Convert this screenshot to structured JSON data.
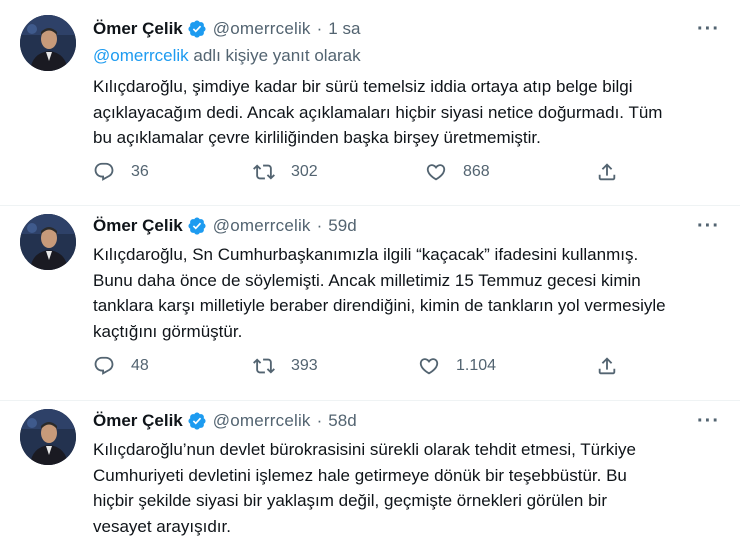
{
  "tweets": [
    {
      "author_name": "Ömer Çelik",
      "handle": "@omerrcelik",
      "separator": "·",
      "time": "1 sa",
      "reply_mention": "@omerrcelik",
      "reply_suffix": " adlı kişiye yanıt olarak",
      "lines": [
        "Kılıçdaroğlu, şimdiye kadar bir sürü temelsiz iddia ortaya atıp belge bilgi",
        "açıklayacağım dedi. Ancak açıklamaları hiçbir siyasi netice doğurmadı. Tüm",
        "bu açıklamalar çevre kirliliğinden başka birşey üretmemiştir."
      ],
      "replies": "36",
      "retweets": "302",
      "likes": "868"
    },
    {
      "author_name": "Ömer Çelik",
      "handle": "@omerrcelik",
      "separator": "·",
      "time": "59d",
      "lines": [
        "Kılıçdaroğlu, Sn Cumhurbaşkanımızla ilgili “kaçacak” ifadesini kullanmış.",
        "Bunu daha önce de söylemişti. Ancak milletimiz 15 Temmuz gecesi kimin",
        "tanklara karşı milletiyle beraber direndiğini, kimin de tankların yol vermesiyle",
        "kaçtığını görmüştür."
      ],
      "replies": "48",
      "retweets": "393",
      "likes": "1.104"
    },
    {
      "author_name": "Ömer Çelik",
      "handle": "@omerrcelik",
      "separator": "·",
      "time": "58d",
      "lines": [
        "Kılıçdaroğlu’nun devlet bürokrasisini sürekli olarak tehdit etmesi, Türkiye",
        "Cumhuriyeti devletini işlemez hale getirmeye dönük bir teşebbüstür. Bu",
        "hiçbir şekilde siyasi bir yaklaşım değil, geçmişte örnekleri görülen bir",
        "vesayet arayışıdır."
      ]
    }
  ],
  "more_label": "···",
  "colors": {
    "accent": "#1d9bf0",
    "secondary_text": "#536471",
    "primary_text": "#0f1419"
  },
  "icons": {
    "verified": "verified-badge-icon",
    "more": "more-options-icon",
    "reply": "reply-icon",
    "retweet": "retweet-icon",
    "like": "heart-icon",
    "share": "share-icon",
    "avatar": "avatar"
  }
}
